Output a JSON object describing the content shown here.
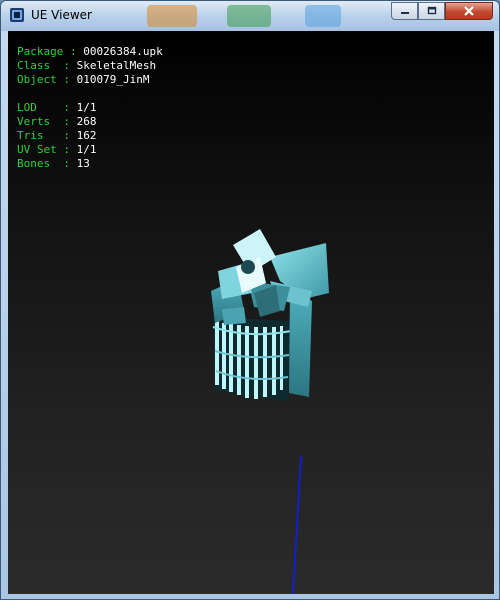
{
  "window": {
    "title": "UE Viewer",
    "controls": {
      "minimize": "minimize",
      "maximize": "maximize",
      "close": "close"
    }
  },
  "info_panel": {
    "sections": [
      [
        {
          "label": "Package",
          "value": "00026384.upk"
        },
        {
          "label": "Class  ",
          "value": "SkeletalMesh"
        },
        {
          "label": "Object ",
          "value": "010079_JinM"
        }
      ],
      [
        {
          "label": "LOD    ",
          "value": "1/1"
        },
        {
          "label": "Verts  ",
          "value": "268"
        },
        {
          "label": "Tris   ",
          "value": "162"
        },
        {
          "label": "UV Set ",
          "value": "1/1"
        },
        {
          "label": "Bones  ",
          "value": "13"
        }
      ]
    ],
    "label_color": "#2ed13a",
    "value_color": "#ffffff"
  },
  "viewport": {
    "background_top": "#000000",
    "background_bottom": "#2b2b2b",
    "mesh_color": "#5fc0cc",
    "axis_color": "#0a1cff"
  }
}
